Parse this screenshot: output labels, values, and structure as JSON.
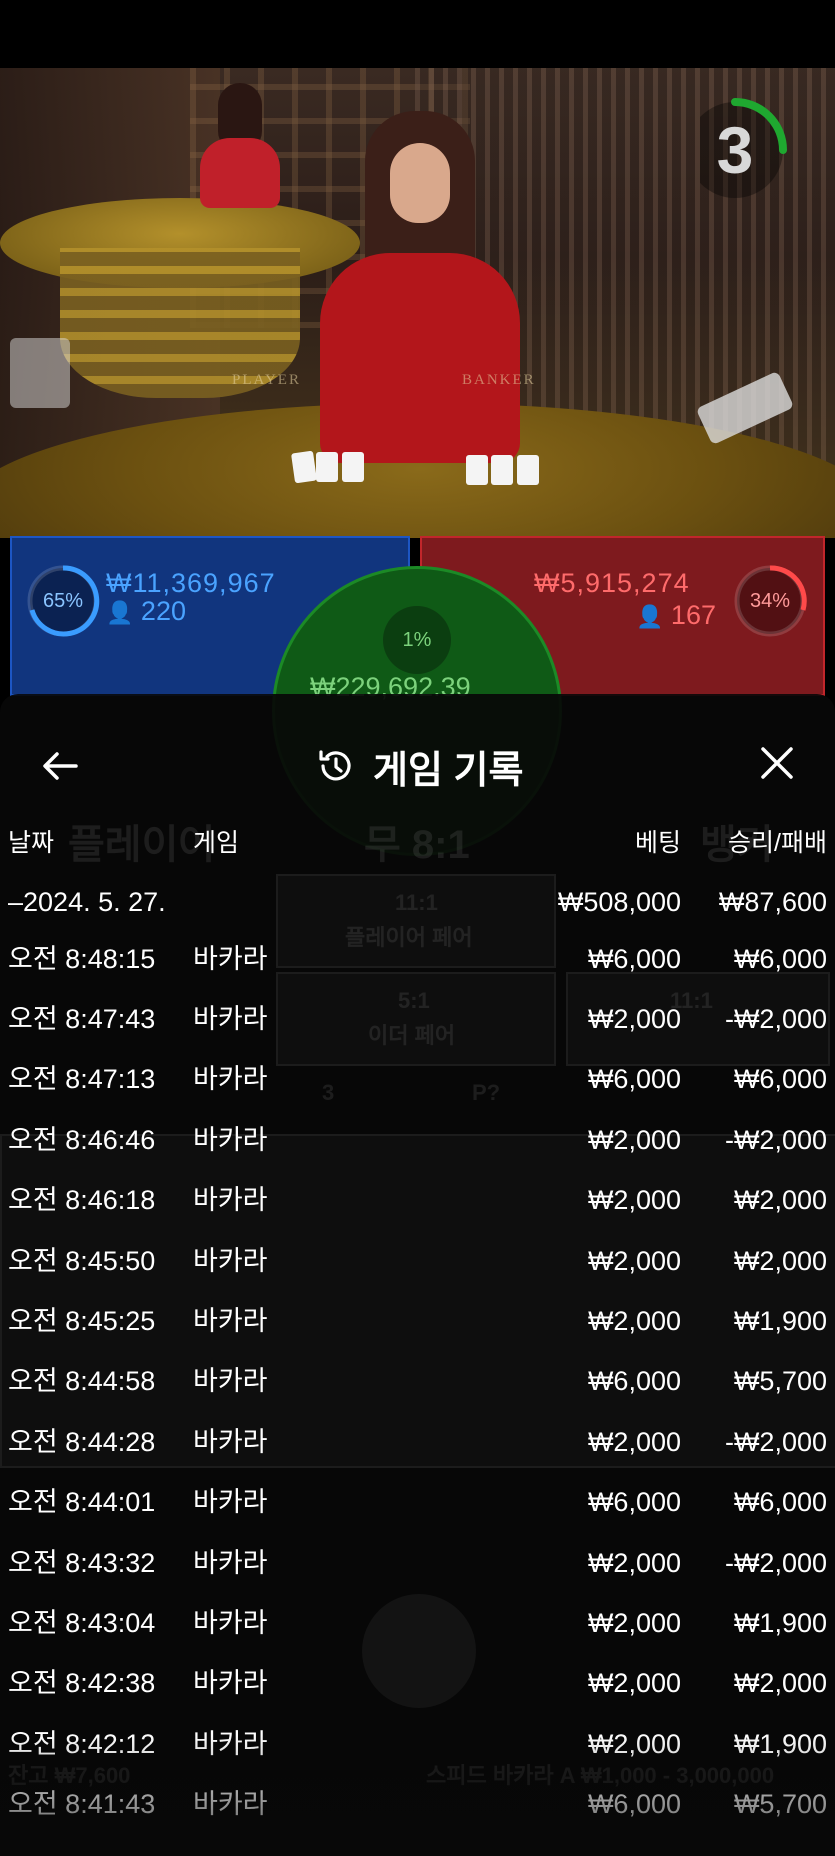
{
  "timer": {
    "value": "3"
  },
  "bets": {
    "player": {
      "percent": "65%",
      "amount": "₩11,369,967",
      "players": "220"
    },
    "banker": {
      "percent": "34%",
      "amount": "₩5,915,274",
      "players": "167"
    },
    "tie": {
      "percent": "1%",
      "amount": "₩229,692.39"
    }
  },
  "table_labels": {
    "player": "PLAYER",
    "banker": "BANKER"
  },
  "background_labels": {
    "player": "플레이어",
    "tie": "무 8:1",
    "banker": "뱅커",
    "player_pair_odds": "11:1",
    "player_pair": "플레이어 페어",
    "either_pair_odds": "5:1",
    "either_pair": "이더 페어",
    "banker_pair_odds": "11:1",
    "road_count": "3",
    "p_question": "P?",
    "balance": "잔고 ₩7,600",
    "table_limit": "스피드 바카라 A ₩1,000 - 3,000,000"
  },
  "history": {
    "title": "게임 기록",
    "columns": {
      "date": "날짜",
      "game": "게임",
      "bet": "베팅",
      "result": "승리/패배"
    },
    "rows": [
      {
        "date": "–2024. 5. 27.",
        "game": "",
        "bet": "₩508,000",
        "result": "₩87,600"
      },
      {
        "date": "오전 8:48:15",
        "game": "바카라",
        "bet": "₩6,000",
        "result": "₩6,000"
      },
      {
        "date": "오전 8:47:43",
        "game": "바카라",
        "bet": "₩2,000",
        "result": "-₩2,000"
      },
      {
        "date": "오전 8:47:13",
        "game": "바카라",
        "bet": "₩6,000",
        "result": "₩6,000"
      },
      {
        "date": "오전 8:46:46",
        "game": "바카라",
        "bet": "₩2,000",
        "result": "-₩2,000"
      },
      {
        "date": "오전 8:46:18",
        "game": "바카라",
        "bet": "₩2,000",
        "result": "₩2,000"
      },
      {
        "date": "오전 8:45:50",
        "game": "바카라",
        "bet": "₩2,000",
        "result": "₩2,000"
      },
      {
        "date": "오전 8:45:25",
        "game": "바카라",
        "bet": "₩2,000",
        "result": "₩1,900"
      },
      {
        "date": "오전 8:44:58",
        "game": "바카라",
        "bet": "₩6,000",
        "result": "₩5,700"
      },
      {
        "date": "오전 8:44:28",
        "game": "바카라",
        "bet": "₩2,000",
        "result": "-₩2,000"
      },
      {
        "date": "오전 8:44:01",
        "game": "바카라",
        "bet": "₩6,000",
        "result": "₩6,000"
      },
      {
        "date": "오전 8:43:32",
        "game": "바카라",
        "bet": "₩2,000",
        "result": "-₩2,000"
      },
      {
        "date": "오전 8:43:04",
        "game": "바카라",
        "bet": "₩2,000",
        "result": "₩1,900"
      },
      {
        "date": "오전 8:42:38",
        "game": "바카라",
        "bet": "₩2,000",
        "result": "₩2,000"
      },
      {
        "date": "오전 8:42:12",
        "game": "바카라",
        "bet": "₩2,000",
        "result": "₩1,900"
      },
      {
        "date": "오전 8:41:43",
        "game": "바카라",
        "bet": "₩6,000",
        "result": "₩5,700"
      }
    ]
  },
  "colors": {
    "player": "#1d56c4",
    "banker": "#c1262b",
    "tie": "#1c8a26",
    "timer_ring": "#1fa830"
  },
  "icons": {
    "back": "arrow-left-icon",
    "history": "history-icon",
    "close": "close-icon",
    "person": "person-icon"
  }
}
